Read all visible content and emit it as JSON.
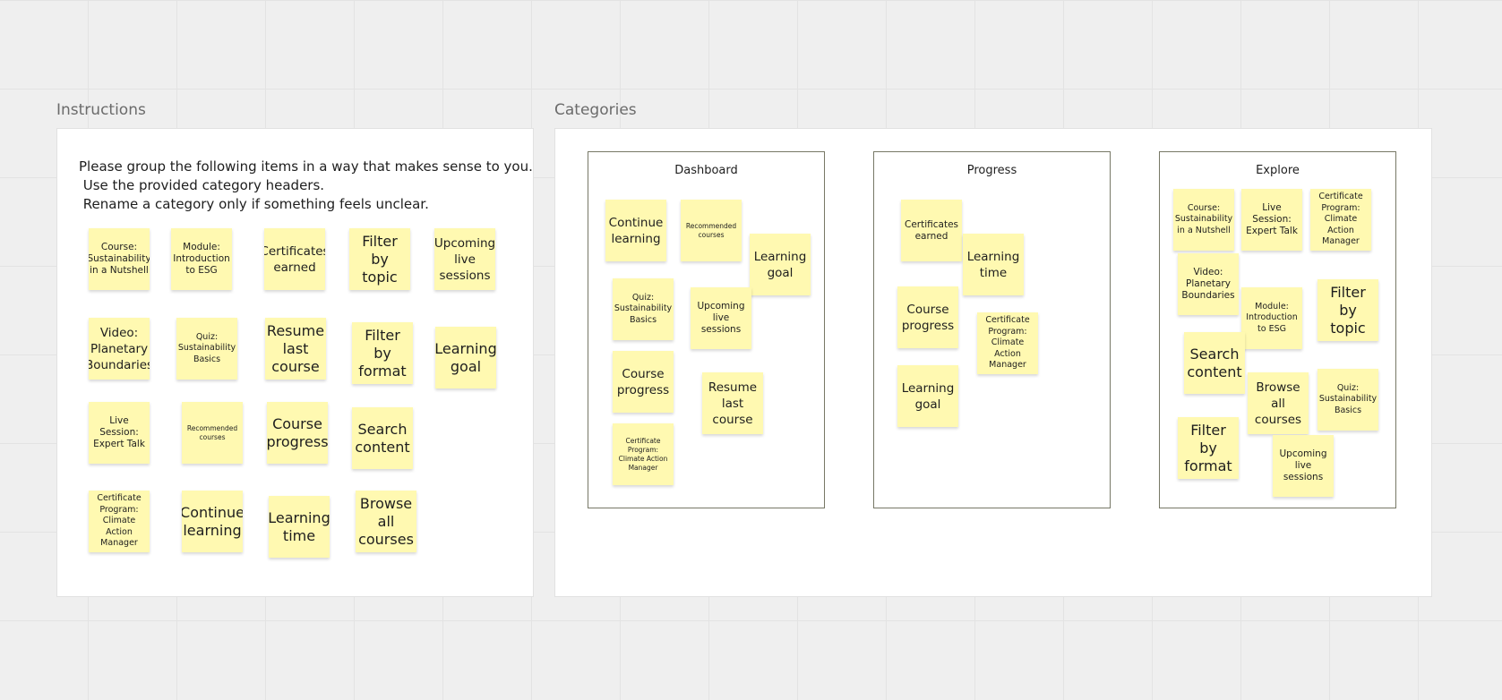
{
  "instructions": {
    "title": "Instructions",
    "lines": [
      "Please group the following items in a way that makes sense to you.",
      " Use the provided category headers.",
      " Rename a category only if something feels unclear."
    ],
    "unsorted_cards": {
      "course_nutshell": "Course: Sustainability in a Nutshell",
      "module_esg": "Module: Introduction to ESG",
      "certificates_earned": "Certificates earned",
      "filter_topic": "Filter by topic",
      "upcoming_live": "Upcoming live sessions",
      "video_planetary": "Video: Planetary Boundaries",
      "quiz_basics": "Quiz: Sustainability Basics",
      "resume_last": "Resume last course",
      "filter_format": "Filter by format",
      "learning_goal": "Learning goal",
      "live_session": "Live Session: Expert Talk",
      "recommended": "Recommended courses",
      "course_progress": "Course progress",
      "search_content": "Search content",
      "certificate_program": "Certificate Program: Climate Action Manager",
      "continue_learning": "Continue learning",
      "learning_time": "Learning time",
      "browse_all": "Browse all courses"
    }
  },
  "categories": {
    "title": "Categories",
    "dashboard": {
      "title": "Dashboard",
      "cards": {
        "continue_learning": "Continue learning",
        "recommended": "Recommended courses",
        "learning_goal": "Learning goal",
        "quiz_basics": "Quiz: Sustainability Basics",
        "upcoming_live": "Upcoming live sessions",
        "course_progress": "Course progress",
        "resume_last": "Resume last course",
        "certificate_program": "Certificate Program: Climate Action Manager"
      }
    },
    "progress": {
      "title": "Progress",
      "cards": {
        "certificates_earned": "Certificates earned",
        "learning_time": "Learning time",
        "course_progress": "Course progress",
        "certificate_program": "Certificate Program: Climate Action Manager",
        "learning_goal": "Learning goal"
      }
    },
    "explore": {
      "title": "Explore",
      "cards": {
        "course_nutshell": "Course: Sustainability in a Nutshell",
        "live_session": "Live Session: Expert Talk",
        "certificate_program": "Certificate Program: Climate Action Manager",
        "video_planetary": "Video: Planetary Boundaries",
        "module_esg": "Module: Introduction to ESG",
        "filter_topic": "Filter by topic",
        "search_content": "Search content",
        "browse_all": "Browse all courses",
        "quiz_basics": "Quiz: Sustainability Basics",
        "filter_format": "Filter by format",
        "upcoming_live": "Upcoming live sessions"
      }
    }
  },
  "colors": {
    "sticky_note": "#fff9b1",
    "canvas": "#efefef",
    "category_border": "#777866"
  }
}
